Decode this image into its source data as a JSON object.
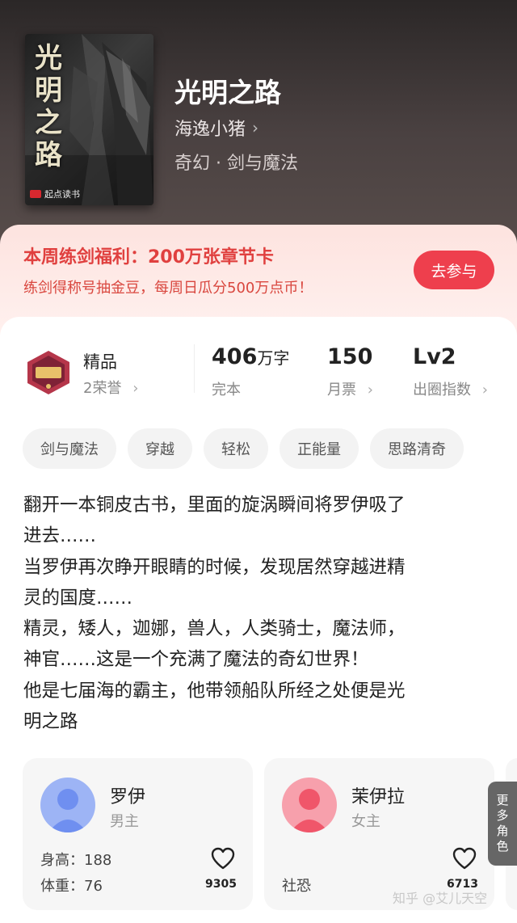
{
  "book": {
    "cover_title": "光明之路",
    "cover_brand": "起点读书",
    "title": "光明之路",
    "author": "海逸小猪",
    "genre": "奇幻 · 剑与魔法"
  },
  "promo": {
    "title": "本周练剑福利：200万张章节卡",
    "subtitle": "练剑得称号抽金豆，每周日瓜分500万点币！",
    "button": "去参与"
  },
  "stats": {
    "badge_label": "精品",
    "badge_sub": "2荣誉",
    "words_value": "406",
    "words_unit": "万字",
    "words_label": "完本",
    "tickets_value": "150",
    "tickets_label": "月票",
    "level_value": "Lv2",
    "level_label": "出圈指数"
  },
  "tags": [
    "剑与魔法",
    "穿越",
    "轻松",
    "正能量",
    "思路清奇"
  ],
  "synopsis": "翻开一本铜皮古书，里面的旋涡瞬间将罗伊吸了\n进去……\n当罗伊再次睁开眼睛的时候，发现居然穿越进精\n灵的国度……\n精灵，矮人，迦娜，兽人，人类骑士，魔法师，\n神官……这是一个充满了魔法的奇幻世界！\n他是七届海的霸主，他带领船队所经之处便是光\n明之路",
  "characters": [
    {
      "name": "罗伊",
      "role": "男主",
      "line1": "身高：188",
      "line2": "体重：76",
      "likes": "9305",
      "avatar_color": "#6f8ff0"
    },
    {
      "name": "茉伊拉",
      "role": "女主",
      "line1": "",
      "line2": "社恐",
      "likes": "6713",
      "avatar_color": "#f0566a"
    }
  ],
  "more_roles": [
    "更",
    "多",
    "角",
    "色"
  ],
  "watermark": "知乎 @艾儿天空",
  "colors": {
    "accent": "#ee3f4d",
    "promo_text": "#e0403f"
  }
}
